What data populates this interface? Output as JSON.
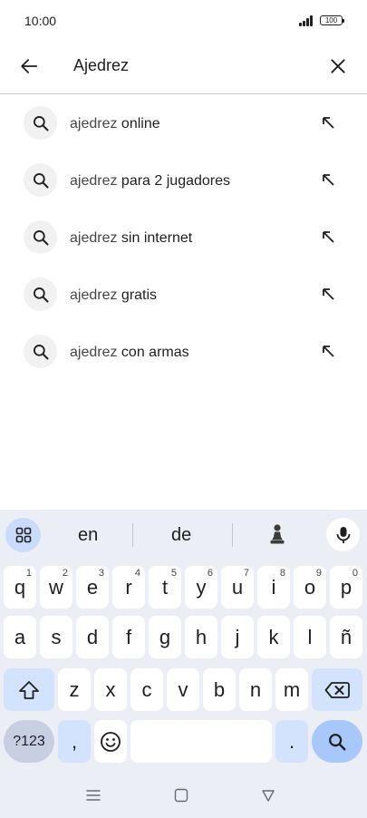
{
  "status_bar": {
    "time": "10:00",
    "battery": "100"
  },
  "search": {
    "query": "Ajedrez"
  },
  "suggestions": [
    {
      "prefix": "ajedrez",
      "suffix": " online"
    },
    {
      "prefix": "ajedrez",
      "suffix": " para 2 jugadores"
    },
    {
      "prefix": "ajedrez",
      "suffix": " sin internet"
    },
    {
      "prefix": "ajedrez",
      "suffix": " gratis"
    },
    {
      "prefix": "ajedrez",
      "suffix": " con armas"
    }
  ],
  "keyboard": {
    "suggestions": [
      "en",
      "de"
    ],
    "row1": [
      {
        "k": "q",
        "s": "1"
      },
      {
        "k": "w",
        "s": "2"
      },
      {
        "k": "e",
        "s": "3"
      },
      {
        "k": "r",
        "s": "4"
      },
      {
        "k": "t",
        "s": "5"
      },
      {
        "k": "y",
        "s": "6"
      },
      {
        "k": "u",
        "s": "7"
      },
      {
        "k": "i",
        "s": "8"
      },
      {
        "k": "o",
        "s": "9"
      },
      {
        "k": "p",
        "s": "0"
      }
    ],
    "row2": [
      "a",
      "s",
      "d",
      "f",
      "g",
      "h",
      "j",
      "k",
      "l",
      "ñ"
    ],
    "row3": [
      "z",
      "x",
      "c",
      "v",
      "b",
      "n",
      "m"
    ],
    "symbols_label": "?123",
    "comma_label": ",",
    "period_label": "."
  },
  "colors": {
    "accent": "#a8c7fa",
    "keyboard_bg": "#eceef6",
    "modifier_key": "#d3e3fd"
  },
  "icons": {
    "back": "arrow-left-icon",
    "clear": "close-icon",
    "suggestion": "search-icon",
    "fill": "arrow-up-left-icon",
    "grid": "grid-icon",
    "chess": "chess-pawn-icon",
    "mic": "mic-icon",
    "shift": "shift-icon",
    "backspace": "backspace-icon",
    "emoji": "emoji-icon",
    "nav_menu": "menu-icon",
    "nav_home": "home-icon",
    "nav_back": "back-triangle-icon"
  }
}
